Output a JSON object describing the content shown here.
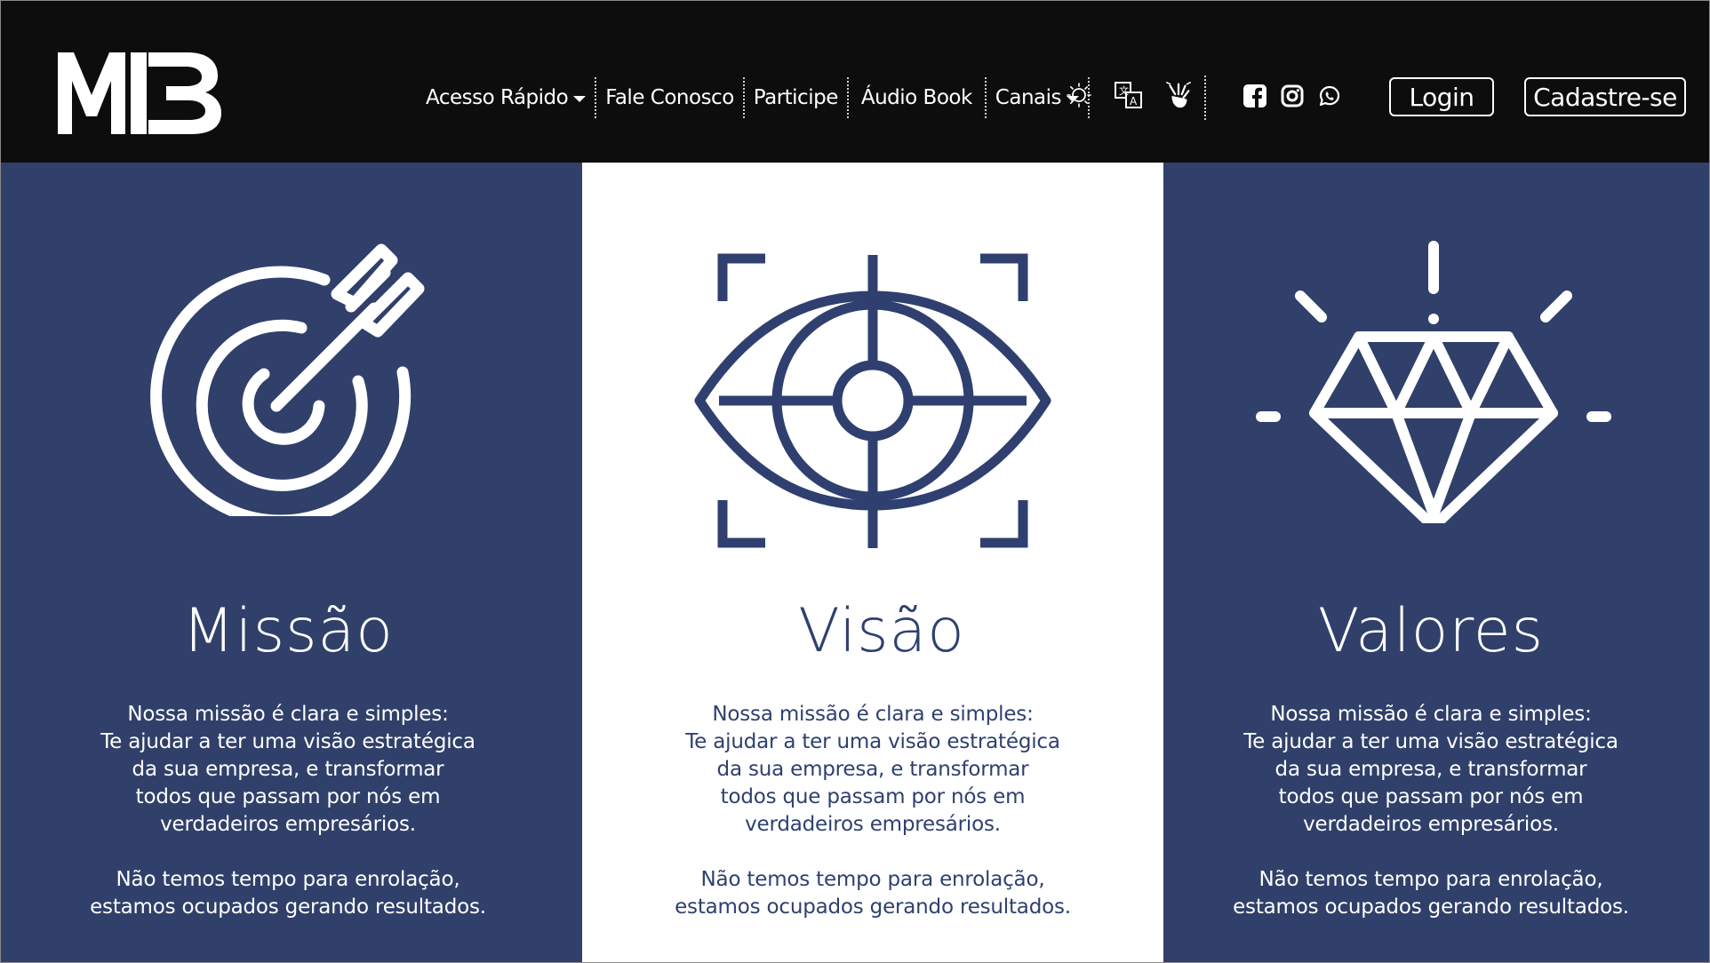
{
  "header": {
    "logo_text": "MB",
    "nav": [
      {
        "label": "Acesso Rápido",
        "dropdown": true
      },
      {
        "label": "Fale Conosco",
        "dropdown": false
      },
      {
        "label": "Participe",
        "dropdown": false
      },
      {
        "label": "Áudio Book",
        "dropdown": false
      },
      {
        "label": "Canais",
        "dropdown": true
      }
    ],
    "accessibility_icons": [
      "contrast-icon",
      "translate-icon",
      "sign-language-icon"
    ],
    "social_icons": [
      "facebook-icon",
      "instagram-icon",
      "whatsapp-icon"
    ],
    "login_label": "Login",
    "signup_label": "Cadastre-se"
  },
  "cards": [
    {
      "title": "Missão",
      "icon": "target-arrow-icon",
      "lines": [
        "Nossa missão é clara e simples:",
        "Te ajudar a ter uma visão estratégica",
        "da sua empresa, e transformar",
        "todos que passam por nós em",
        "verdadeiros empresários."
      ],
      "closing": [
        "Não temos tempo para enrolação,",
        "estamos ocupados gerando resultados."
      ]
    },
    {
      "title": "Visão",
      "icon": "eye-target-icon",
      "lines": [
        "Nossa missão é clara e simples:",
        "Te ajudar a ter uma visão estratégica",
        "da sua empresa, e transformar",
        "todos que passam por nós em",
        "verdadeiros empresários."
      ],
      "closing": [
        "Não temos tempo para enrolação,",
        "estamos ocupados gerando resultados."
      ]
    },
    {
      "title": "Valores",
      "icon": "diamond-icon",
      "lines": [
        "Nossa missão é clara e simples:",
        "Te ajudar a ter uma visão estratégica",
        "da sua empresa, e transformar",
        "todos que passam por nós em",
        "verdadeiros empresários."
      ],
      "closing": [
        "Não temos tempo para enrolação,",
        "estamos ocupados gerando resultados."
      ]
    }
  ],
  "colors": {
    "navy": "#30406a",
    "header": "#0d0d0d",
    "white": "#ffffff"
  }
}
